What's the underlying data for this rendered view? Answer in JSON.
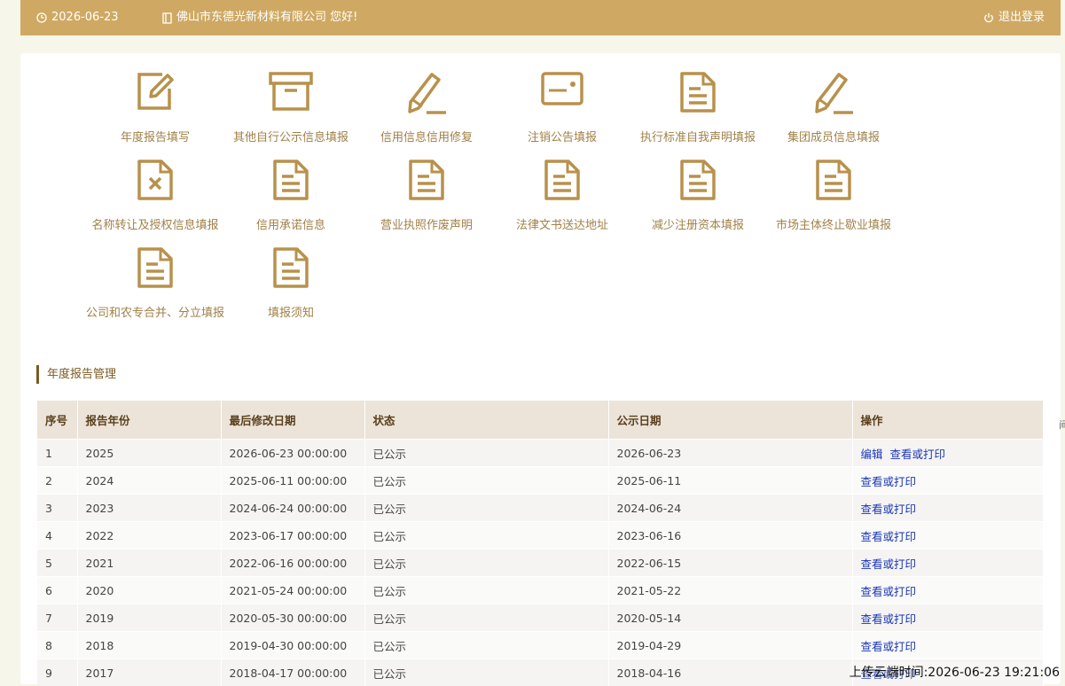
{
  "header": {
    "date": "2026-06-23",
    "greeting": "佛山市东德光新材料有限公司 您好!",
    "logout": "退出登录"
  },
  "tiles": [
    {
      "label": "年度报告填写",
      "icon": "edit-icon"
    },
    {
      "label": "其他自行公示信息填报",
      "icon": "archive-box-icon"
    },
    {
      "label": "信用信息信用修复",
      "icon": "pencil-icon"
    },
    {
      "label": "注销公告填报",
      "icon": "id-card-icon"
    },
    {
      "label": "执行标准自我声明填报",
      "icon": "document-icon"
    },
    {
      "label": "集团成员信息填报",
      "icon": "pencil-icon"
    },
    {
      "label": "名称转让及授权信息填报",
      "icon": "document-x-icon"
    },
    {
      "label": "信用承诺信息",
      "icon": "document-icon"
    },
    {
      "label": "营业执照作废声明",
      "icon": "document-icon"
    },
    {
      "label": "法律文书送达地址",
      "icon": "document-icon"
    },
    {
      "label": "减少注册资本填报",
      "icon": "document-icon"
    },
    {
      "label": "市场主体终止歇业填报",
      "icon": "document-icon"
    },
    {
      "label": "公司和农专合并、分立填报",
      "icon": "document-icon"
    },
    {
      "label": "填报须知",
      "icon": "document-icon"
    }
  ],
  "section": {
    "title": "年度报告管理"
  },
  "table": {
    "headers": [
      "序号",
      "报告年份",
      "最后修改日期",
      "状态",
      "公示日期",
      "操作"
    ],
    "rows": [
      {
        "no": "1",
        "year": "2025",
        "modified": "2026-06-23 00:00:00",
        "status": "已公示",
        "publish": "2026-06-23",
        "actions": [
          "编辑",
          "查看或打印"
        ]
      },
      {
        "no": "2",
        "year": "2024",
        "modified": "2025-06-11 00:00:00",
        "status": "已公示",
        "publish": "2025-06-11",
        "actions": [
          "查看或打印"
        ]
      },
      {
        "no": "3",
        "year": "2023",
        "modified": "2024-06-24 00:00:00",
        "status": "已公示",
        "publish": "2024-06-24",
        "actions": [
          "查看或打印"
        ]
      },
      {
        "no": "4",
        "year": "2022",
        "modified": "2023-06-17 00:00:00",
        "status": "已公示",
        "publish": "2023-06-16",
        "actions": [
          "查看或打印"
        ]
      },
      {
        "no": "5",
        "year": "2021",
        "modified": "2022-06-16 00:00:00",
        "status": "已公示",
        "publish": "2022-06-15",
        "actions": [
          "查看或打印"
        ]
      },
      {
        "no": "6",
        "year": "2020",
        "modified": "2021-05-24 00:00:00",
        "status": "已公示",
        "publish": "2021-05-22",
        "actions": [
          "查看或打印"
        ]
      },
      {
        "no": "7",
        "year": "2019",
        "modified": "2020-05-30 00:00:00",
        "status": "已公示",
        "publish": "2020-05-14",
        "actions": [
          "查看或打印"
        ]
      },
      {
        "no": "8",
        "year": "2018",
        "modified": "2019-04-30 00:00:00",
        "status": "已公示",
        "publish": "2019-04-29",
        "actions": [
          "查看或打印"
        ]
      },
      {
        "no": "9",
        "year": "2017",
        "modified": "2018-04-17 00:00:00",
        "status": "已公示",
        "publish": "2018-04-16",
        "actions": [
          "查看或打印"
        ]
      }
    ]
  },
  "footer": {
    "upload_time": "上传云端时间:2026-06-23 19:21:06"
  },
  "edge_glyph": "间",
  "colors": {
    "brand": "#cfa963",
    "icon": "#b8914b",
    "link": "#1b38b6",
    "header_bg": "#ece4d9"
  }
}
